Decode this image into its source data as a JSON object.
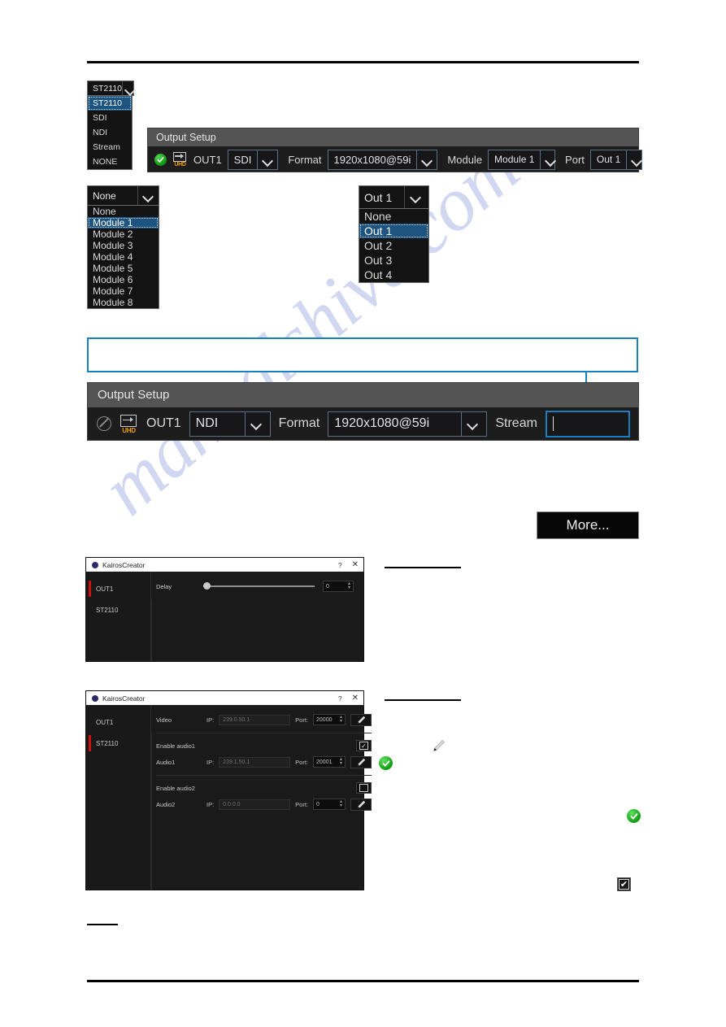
{
  "watermark": {
    "text": "manualshive.com"
  },
  "format_dropdown": {
    "header_value": "ST2110",
    "items": [
      "ST2110",
      "SDI",
      "NDI",
      "Stream",
      "NONE"
    ],
    "selected_index": 0
  },
  "module_dropdown": {
    "header_value": "None",
    "items": [
      "None",
      "Module 1",
      "Module 2",
      "Module 3",
      "Module 4",
      "Module 5",
      "Module 6",
      "Module 7",
      "Module 8"
    ],
    "selected_index": 1
  },
  "port_dropdown": {
    "header_value": "Out 1",
    "items": [
      "None",
      "Out 1",
      "Out 2",
      "Out 3",
      "Out 4"
    ],
    "selected_index": 1
  },
  "output_setup_sdi": {
    "title": "Output Setup",
    "status_icon": "enabled-check-icon",
    "resolution_icon": "uhd-icon",
    "uhd_label": "UHD",
    "output_name": "OUT1",
    "protocol_value": "SDI",
    "format_label": "Format",
    "format_value": "1920x1080@59i",
    "module_label": "Module",
    "module_value": "Module 1",
    "port_label": "Port",
    "port_value": "Out 1"
  },
  "output_setup_ndi": {
    "title": "Output Setup",
    "status_icon": "disabled-ban-icon",
    "resolution_icon": "uhd-icon",
    "uhd_label": "UHD",
    "output_name": "OUT1",
    "protocol_value": "NDI",
    "format_label": "Format",
    "format_value": "1920x1080@59i",
    "stream_label": "Stream",
    "stream_value": ""
  },
  "more_button": {
    "label": "More..."
  },
  "dialog_delay": {
    "title": "KairosCreator",
    "help_glyph": "?",
    "close_glyph": "✕",
    "side_items": [
      "OUT1",
      "ST2110"
    ],
    "active_side_index": 0,
    "delay_label": "Delay",
    "delay_value": "0",
    "slider_position_percent": 0
  },
  "dialog_st2110": {
    "title": "KairosCreator",
    "help_glyph": "?",
    "close_glyph": "✕",
    "side_items": [
      "OUT1",
      "ST2110"
    ],
    "active_side_index": 1,
    "rows": [
      {
        "name": "Video",
        "ip_label": "IP:",
        "ip_value": "239.0.50.1",
        "port_label": "Port:",
        "port_value": "20000",
        "pen_icon": "pen-icon"
      },
      {
        "name": "Audio1",
        "ip_label": "IP:",
        "ip_value": "239.1.50.1",
        "port_label": "Port:",
        "port_value": "20001",
        "pen_icon": "pen-icon"
      },
      {
        "name": "Audio2",
        "ip_label": "IP:",
        "ip_value": "0.0.0.0",
        "port_label": "Port:",
        "port_value": "0",
        "pen_icon": "pen-icon"
      }
    ],
    "enable_audio1_label": "Enable audio1",
    "enable_audio1_checked": true,
    "enable_audio2_label": "Enable audio2",
    "enable_audio2_checked": false
  },
  "annotations": {
    "green_check_icon": "enabled-check-icon",
    "pen_icon": "pen-icon",
    "checkbox_icon": "checked-checkbox-icon",
    "check_glyph": "✔"
  },
  "colors": {
    "accent_blue": "#1a7fc1",
    "selection_blue": "#1e5480",
    "status_green": "#19a719",
    "active_red": "#cc1111",
    "uhd_orange": "#f0a000",
    "panel_title_gray": "#545454",
    "panel_bg": "#1d1d1d"
  }
}
